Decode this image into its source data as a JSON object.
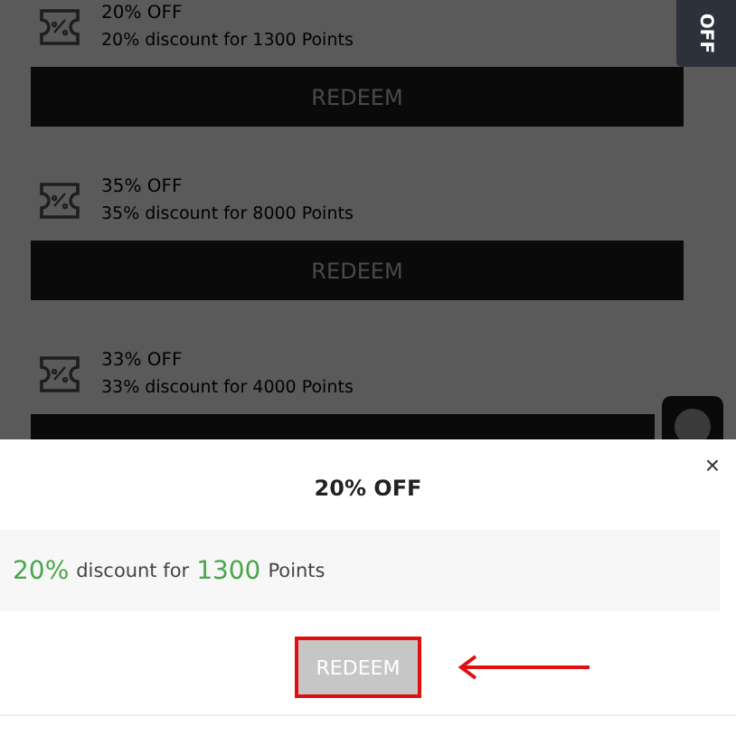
{
  "side_tab": {
    "label": "OFF"
  },
  "rewards": [
    {
      "title": "20% OFF",
      "description": "20% discount for 1300 Points",
      "button": "REDEEM"
    },
    {
      "title": "35% OFF",
      "description": "35% discount for 8000 Points",
      "button": "REDEEM"
    },
    {
      "title": "33% OFF",
      "description": "33% discount for 4000 Points"
    }
  ],
  "modal": {
    "title": "20% OFF",
    "close": "×",
    "summary": [
      {
        "text": "20%",
        "highlight": true
      },
      {
        "text": "discount for",
        "highlight": false
      },
      {
        "text": "1300",
        "highlight": true
      },
      {
        "text": "Points",
        "highlight": false
      }
    ],
    "button": {
      "label": "REDEEM",
      "disabled": true,
      "annotated": true
    }
  }
}
